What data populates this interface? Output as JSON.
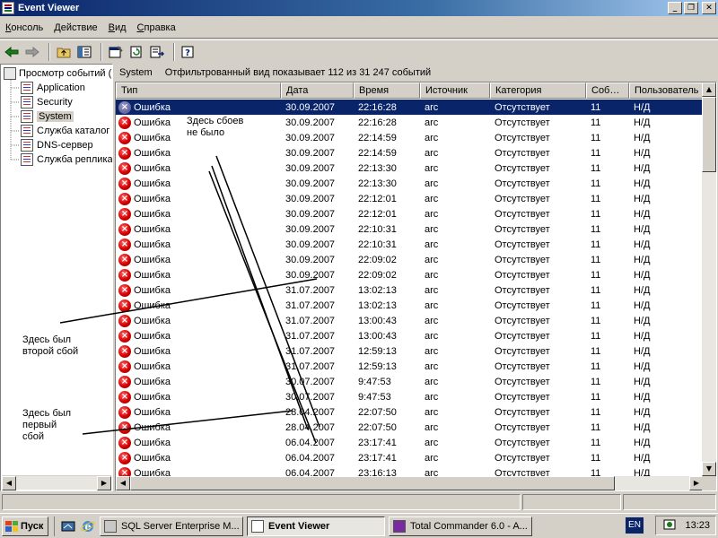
{
  "window": {
    "title": "Event Viewer",
    "minimize": "_",
    "maximize": "❐",
    "close": "✕"
  },
  "menu": [
    "Консоль",
    "Действие",
    "Вид",
    "Справка"
  ],
  "tree": {
    "root": "Просмотр событий (",
    "items": [
      "Application",
      "Security",
      "System",
      "Служба каталог",
      "DNS-сервер",
      "Служба реплика"
    ],
    "selected": "System"
  },
  "info": {
    "node": "System",
    "filter_text": "Отфильтрованный вид показывает 112 из 31 247 событий"
  },
  "columns": [
    "Тип",
    "Дата",
    "Время",
    "Источник",
    "Категория",
    "Соб…",
    "Пользователь"
  ],
  "rows": [
    {
      "type": "Ошибка",
      "date": "30.09.2007",
      "time": "22:16:28",
      "source": "arc",
      "category": "Отсутствует",
      "event": "11",
      "user": "Н/Д"
    },
    {
      "type": "Ошибка",
      "date": "30.09.2007",
      "time": "22:16:28",
      "source": "arc",
      "category": "Отсутствует",
      "event": "11",
      "user": "Н/Д"
    },
    {
      "type": "Ошибка",
      "date": "30.09.2007",
      "time": "22:14:59",
      "source": "arc",
      "category": "Отсутствует",
      "event": "11",
      "user": "Н/Д"
    },
    {
      "type": "Ошибка",
      "date": "30.09.2007",
      "time": "22:14:59",
      "source": "arc",
      "category": "Отсутствует",
      "event": "11",
      "user": "Н/Д"
    },
    {
      "type": "Ошибка",
      "date": "30.09.2007",
      "time": "22:13:30",
      "source": "arc",
      "category": "Отсутствует",
      "event": "11",
      "user": "Н/Д"
    },
    {
      "type": "Ошибка",
      "date": "30.09.2007",
      "time": "22:13:30",
      "source": "arc",
      "category": "Отсутствует",
      "event": "11",
      "user": "Н/Д"
    },
    {
      "type": "Ошибка",
      "date": "30.09.2007",
      "time": "22:12:01",
      "source": "arc",
      "category": "Отсутствует",
      "event": "11",
      "user": "Н/Д"
    },
    {
      "type": "Ошибка",
      "date": "30.09.2007",
      "time": "22:12:01",
      "source": "arc",
      "category": "Отсутствует",
      "event": "11",
      "user": "Н/Д"
    },
    {
      "type": "Ошибка",
      "date": "30.09.2007",
      "time": "22:10:31",
      "source": "arc",
      "category": "Отсутствует",
      "event": "11",
      "user": "Н/Д"
    },
    {
      "type": "Ошибка",
      "date": "30.09.2007",
      "time": "22:10:31",
      "source": "arc",
      "category": "Отсутствует",
      "event": "11",
      "user": "Н/Д"
    },
    {
      "type": "Ошибка",
      "date": "30.09.2007",
      "time": "22:09:02",
      "source": "arc",
      "category": "Отсутствует",
      "event": "11",
      "user": "Н/Д"
    },
    {
      "type": "Ошибка",
      "date": "30.09.2007",
      "time": "22:09:02",
      "source": "arc",
      "category": "Отсутствует",
      "event": "11",
      "user": "Н/Д"
    },
    {
      "type": "Ошибка",
      "date": "31.07.2007",
      "time": "13:02:13",
      "source": "arc",
      "category": "Отсутствует",
      "event": "11",
      "user": "Н/Д"
    },
    {
      "type": "Ошибка",
      "date": "31.07.2007",
      "time": "13:02:13",
      "source": "arc",
      "category": "Отсутствует",
      "event": "11",
      "user": "Н/Д"
    },
    {
      "type": "Ошибка",
      "date": "31.07.2007",
      "time": "13:00:43",
      "source": "arc",
      "category": "Отсутствует",
      "event": "11",
      "user": "Н/Д"
    },
    {
      "type": "Ошибка",
      "date": "31.07.2007",
      "time": "13:00:43",
      "source": "arc",
      "category": "Отсутствует",
      "event": "11",
      "user": "Н/Д"
    },
    {
      "type": "Ошибка",
      "date": "31.07.2007",
      "time": "12:59:13",
      "source": "arc",
      "category": "Отсутствует",
      "event": "11",
      "user": "Н/Д"
    },
    {
      "type": "Ошибка",
      "date": "31.07.2007",
      "time": "12:59:13",
      "source": "arc",
      "category": "Отсутствует",
      "event": "11",
      "user": "Н/Д"
    },
    {
      "type": "Ошибка",
      "date": "30.07.2007",
      "time": "9:47:53",
      "source": "arc",
      "category": "Отсутствует",
      "event": "11",
      "user": "Н/Д"
    },
    {
      "type": "Ошибка",
      "date": "30.07.2007",
      "time": "9:47:53",
      "source": "arc",
      "category": "Отсутствует",
      "event": "11",
      "user": "Н/Д"
    },
    {
      "type": "Ошибка",
      "date": "28.04.2007",
      "time": "22:07:50",
      "source": "arc",
      "category": "Отсутствует",
      "event": "11",
      "user": "Н/Д"
    },
    {
      "type": "Ошибка",
      "date": "28.04.2007",
      "time": "22:07:50",
      "source": "arc",
      "category": "Отсутствует",
      "event": "11",
      "user": "Н/Д"
    },
    {
      "type": "Ошибка",
      "date": "06.04.2007",
      "time": "23:17:41",
      "source": "arc",
      "category": "Отсутствует",
      "event": "11",
      "user": "Н/Д"
    },
    {
      "type": "Ошибка",
      "date": "06.04.2007",
      "time": "23:17:41",
      "source": "arc",
      "category": "Отсутствует",
      "event": "11",
      "user": "Н/Д"
    },
    {
      "type": "Ошибка",
      "date": "06.04.2007",
      "time": "23:16:13",
      "source": "arc",
      "category": "Отсутствует",
      "event": "11",
      "user": "Н/Д"
    }
  ],
  "annotations": {
    "no_failures": "Здесь сбоев\nне было",
    "second_failure": "Здесь был\nвторой сбой",
    "first_failure": "Здесь был\nпервый\nсбой"
  },
  "taskbar": {
    "start": "Пуск",
    "tasks": [
      "SQL Server Enterprise M...",
      "Event Viewer",
      "Total Commander 6.0 - A..."
    ],
    "lang": "EN",
    "clock": "13:23"
  }
}
